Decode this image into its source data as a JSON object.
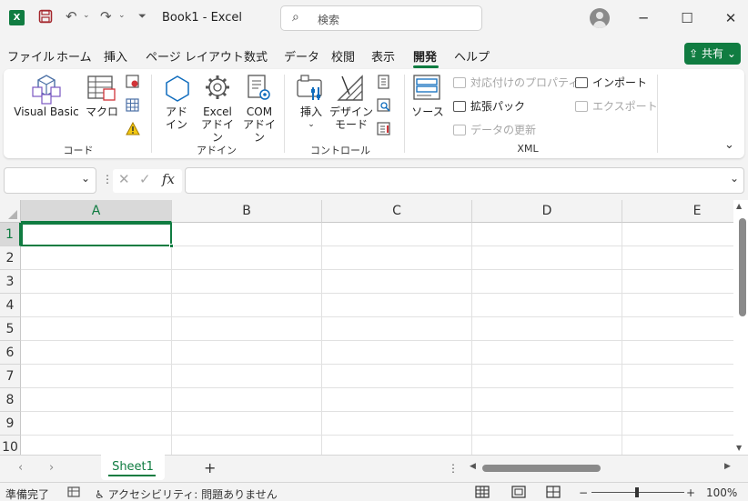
{
  "titlebar": {
    "app_logo": "X",
    "title": "Book1  -  Excel",
    "search_placeholder": "検索",
    "search_icon": "⌕"
  },
  "tabs": [
    "ファイル",
    "ホーム",
    "挿入",
    "ページ レイアウト",
    "数式",
    "データ",
    "校閲",
    "表示",
    "開発",
    "ヘルプ"
  ],
  "active_tab": "開発",
  "share_label": "共有",
  "ribbon": {
    "code": {
      "group_label": "コード",
      "visual_basic": "Visual Basic",
      "macro": "マクロ"
    },
    "addins": {
      "group_label": "アドイン",
      "addin_line1": "アド",
      "addin_line2": "イン",
      "excel_line1": "Excel",
      "excel_line2": "アドイン",
      "com_line1": "COM",
      "com_line2": "アドイン"
    },
    "controls": {
      "group_label": "コントロール",
      "insert": "挿入",
      "design_line1": "デザイン",
      "design_line2": "モード"
    },
    "xml": {
      "group_label": "XML",
      "source": "ソース",
      "map_properties": "対応付けのプロパティ",
      "expansion_packs": "拡張パック",
      "refresh_data": "データの更新",
      "import": "インポート",
      "export": "エクスポート"
    }
  },
  "formula_bar": {
    "namebox_value": "",
    "formula_value": "",
    "fx": "fx"
  },
  "grid": {
    "columns": [
      "A",
      "B",
      "C",
      "D",
      "E"
    ],
    "rows": [
      "1",
      "2",
      "3",
      "4",
      "5",
      "6",
      "7",
      "8",
      "9",
      "10"
    ],
    "active_cell": "A1"
  },
  "sheets": [
    "Sheet1"
  ],
  "statusbar": {
    "ready": "準備完了",
    "accessibility": "アクセシビリティ: 問題ありません",
    "zoom": "100%"
  }
}
